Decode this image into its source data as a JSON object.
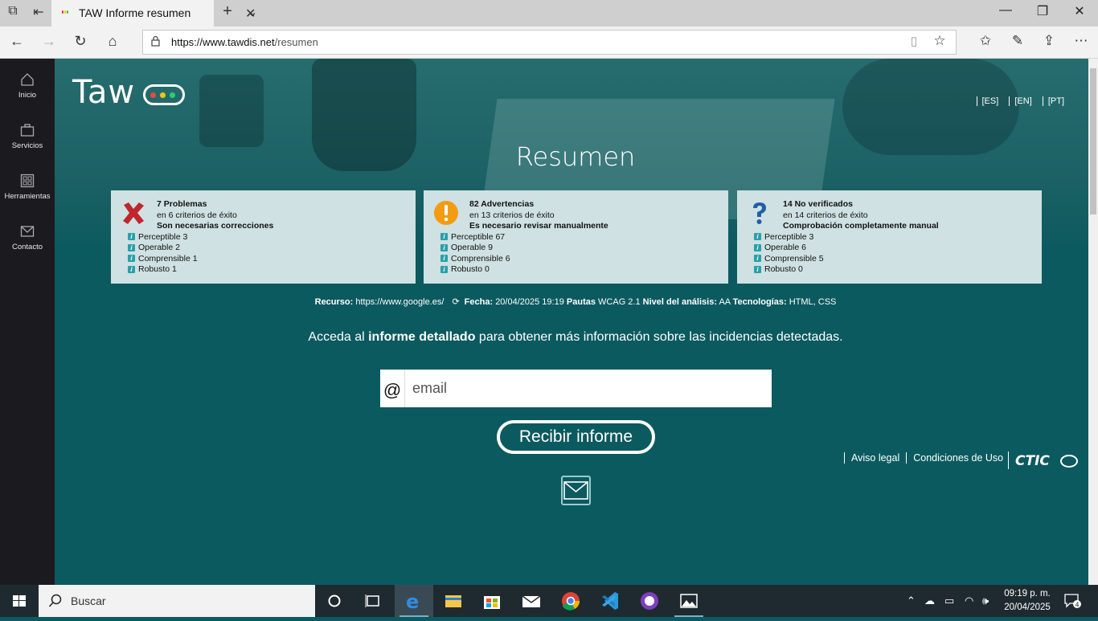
{
  "browser": {
    "tab_title": "TAW Informe resumen",
    "url_host": "https://www.tawdis.net",
    "url_path": "/resumen"
  },
  "sidebar": {
    "items": [
      {
        "label": "Inicio",
        "icon": "home-icon"
      },
      {
        "label": "Servicios",
        "icon": "briefcase-icon"
      },
      {
        "label": "Herramientas",
        "icon": "tools-grid-icon"
      },
      {
        "label": "Contacto",
        "icon": "mail-icon"
      }
    ]
  },
  "header": {
    "logo_text": "Taw",
    "languages": [
      "[ES]",
      "[EN]",
      "[PT]"
    ]
  },
  "page_title": "Resumen",
  "cards": [
    {
      "icon": "error-x-icon",
      "heading": "7 Problemas",
      "subheading": "en 6 criterios de éxito",
      "note": "Son necesarias correcciones",
      "items": [
        "Perceptible 3",
        "Operable 2",
        "Comprensible 1",
        "Robusto 1"
      ]
    },
    {
      "icon": "warning-icon",
      "heading": "82 Advertencias",
      "subheading": "en 13 criterios de éxito",
      "note": "Es necesario revisar manualmente",
      "items": [
        "Perceptible 67",
        "Operable 9",
        "Comprensible 6",
        "Robusto 0"
      ]
    },
    {
      "icon": "question-icon",
      "heading": "14 No verificados",
      "subheading": "en 14 criterios de éxito",
      "note": "Comprobación completamente manual",
      "items": [
        "Perceptible 3",
        "Operable 6",
        "Comprensible 5",
        "Robusto 0"
      ]
    }
  ],
  "meta": {
    "resource_label": "Recurso:",
    "resource_value": "https://www.google.es/",
    "date_label": "Fecha:",
    "date_value": "20/04/2025 19:19",
    "guidelines_label": "Pautas",
    "guidelines_value": "WCAG 2.1",
    "level_label": "Nivel del análisis:",
    "level_value": "AA",
    "tech_label": "Tecnologías:",
    "tech_value": "HTML, CSS"
  },
  "access": {
    "before": "Acceda al ",
    "bold": "informe detallado",
    "after": " para obtener más información sobre las incidencias detectadas."
  },
  "form": {
    "at_symbol": "@",
    "email_placeholder": "email",
    "submit_label": "Recibir informe"
  },
  "footer": {
    "legal": "Aviso legal",
    "terms": "Condiciones de Uso",
    "brand": "CTIC"
  },
  "taskbar": {
    "search_label": "Buscar",
    "time": "09:19 p. m.",
    "date": "20/04/2025",
    "notifications": "4"
  },
  "colors": {
    "teal_bg": "#0b5a5f",
    "card_bg": "#cfe1e2",
    "sidebar_bg": "#1b1b1f"
  }
}
